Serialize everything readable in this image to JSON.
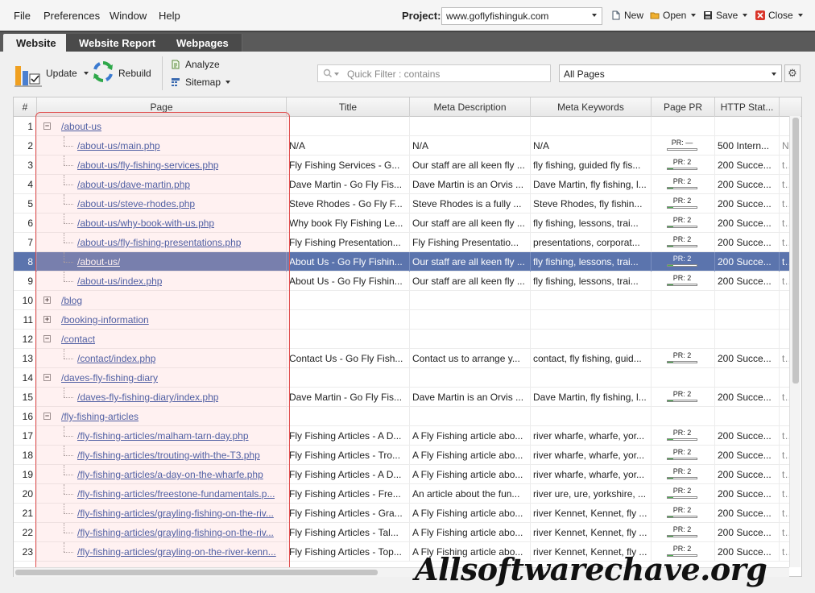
{
  "menu": {
    "file": "File",
    "preferences": "Preferences",
    "window": "Window",
    "help": "Help"
  },
  "project": {
    "label": "Project:",
    "value": "www.goflyfishinguk.com"
  },
  "toolbar_top": {
    "new_label": "New",
    "open_label": "Open",
    "save_label": "Save",
    "close_label": "Close"
  },
  "tabs": [
    "Website",
    "Website Report",
    "Webpages"
  ],
  "actions": {
    "update": "Update",
    "rebuild": "Rebuild",
    "analyze": "Analyze",
    "sitemap": "Sitemap"
  },
  "filter": {
    "placeholder": "Quick Filter : contains",
    "scope": "All Pages"
  },
  "columns": [
    "#",
    "Page",
    "Title",
    "Meta Description",
    "Meta Keywords",
    "Page PR",
    "HTTP Stat..."
  ],
  "rows": [
    {
      "n": "1",
      "page": "/about-us",
      "level": 0,
      "toggle": "minus",
      "title": "",
      "desc": "",
      "kw": "",
      "pr": "",
      "status": "",
      "extra": ""
    },
    {
      "n": "2",
      "page": "/about-us/main.php",
      "level": 1,
      "title": "N/A",
      "desc": "N/A",
      "kw": "N/A",
      "pr": "PR: —",
      "prfill": 0,
      "status": "500 Intern...",
      "extra": "N"
    },
    {
      "n": "3",
      "page": "/about-us/fly-fishing-services.php",
      "level": 1,
      "title": "Fly Fishing Services - G...",
      "desc": "Our staff are all keen fly ...",
      "kw": "fly fishing, guided fly fis...",
      "pr": "PR: 2",
      "prfill": 0.2,
      "status": "200 Succe...",
      "extra": "te"
    },
    {
      "n": "4",
      "page": "/about-us/dave-martin.php",
      "level": 1,
      "title": "Dave Martin - Go Fly Fis...",
      "desc": "Dave Martin is an Orvis ...",
      "kw": "Dave Martin, fly fishing, l...",
      "pr": "PR: 2",
      "prfill": 0.2,
      "status": "200 Succe...",
      "extra": "te"
    },
    {
      "n": "5",
      "page": "/about-us/steve-rhodes.php",
      "level": 1,
      "title": "Steve Rhodes - Go Fly F...",
      "desc": "Steve Rhodes is a fully ...",
      "kw": "Steve Rhodes, fly fishin...",
      "pr": "PR: 2",
      "prfill": 0.2,
      "status": "200 Succe...",
      "extra": "te"
    },
    {
      "n": "6",
      "page": "/about-us/why-book-with-us.php",
      "level": 1,
      "title": "Why book Fly Fishing Le...",
      "desc": "Our staff are all keen fly ...",
      "kw": "fly fishing, lessons, trai...",
      "pr": "PR: 2",
      "prfill": 0.2,
      "status": "200 Succe...",
      "extra": "te"
    },
    {
      "n": "7",
      "page": "/about-us/fly-fishing-presentations.php",
      "level": 1,
      "title": "Fly Fishing Presentation...",
      "desc": "Fly Fishing Presentatio...",
      "kw": "presentations, corporat...",
      "pr": "PR: 2",
      "prfill": 0.2,
      "status": "200 Succe...",
      "extra": "te"
    },
    {
      "n": "8",
      "page": "/about-us/",
      "level": 1,
      "selected": true,
      "title": "About Us - Go Fly Fishin...",
      "desc": "Our staff are all keen fly ...",
      "kw": "fly fishing, lessons, trai...",
      "pr": "PR: 2",
      "prfill": 0.2,
      "status": "200 Succe...",
      "extra": "te"
    },
    {
      "n": "9",
      "page": "/about-us/index.php",
      "level": 1,
      "title": "About Us - Go Fly Fishin...",
      "desc": "Our staff are all keen fly ...",
      "kw": "fly fishing, lessons, trai...",
      "pr": "PR: 2",
      "prfill": 0.2,
      "status": "200 Succe...",
      "extra": "te"
    },
    {
      "n": "10",
      "page": "/blog",
      "level": 0,
      "toggle": "plus",
      "title": "",
      "desc": "",
      "kw": "",
      "pr": "",
      "status": "",
      "extra": ""
    },
    {
      "n": "11",
      "page": "/booking-information",
      "level": 0,
      "toggle": "plus",
      "title": "",
      "desc": "",
      "kw": "",
      "pr": "",
      "status": "",
      "extra": ""
    },
    {
      "n": "12",
      "page": "/contact",
      "level": 0,
      "toggle": "minus",
      "title": "",
      "desc": "",
      "kw": "",
      "pr": "",
      "status": "",
      "extra": ""
    },
    {
      "n": "13",
      "page": "/contact/index.php",
      "level": 1,
      "title": "Contact Us - Go Fly Fish...",
      "desc": "Contact us to arrange y...",
      "kw": "contact, fly fishing, guid...",
      "pr": "PR: 2",
      "prfill": 0.2,
      "status": "200 Succe...",
      "extra": "te"
    },
    {
      "n": "14",
      "page": "/daves-fly-fishing-diary",
      "level": 0,
      "toggle": "minus",
      "title": "",
      "desc": "",
      "kw": "",
      "pr": "",
      "status": "",
      "extra": ""
    },
    {
      "n": "15",
      "page": "/daves-fly-fishing-diary/index.php",
      "level": 1,
      "title": "Dave Martin - Go Fly Fis...",
      "desc": "Dave Martin is an Orvis ...",
      "kw": "Dave Martin, fly fishing, l...",
      "pr": "PR: 2",
      "prfill": 0.2,
      "status": "200 Succe...",
      "extra": "te"
    },
    {
      "n": "16",
      "page": "/fly-fishing-articles",
      "level": 0,
      "toggle": "minus",
      "title": "",
      "desc": "",
      "kw": "",
      "pr": "",
      "status": "",
      "extra": ""
    },
    {
      "n": "17",
      "page": "/fly-fishing-articles/malham-tarn-day.php",
      "level": 1,
      "title": "Fly Fishing Articles - A D...",
      "desc": "A Fly Fishing article abo...",
      "kw": "river wharfe, wharfe, yor...",
      "pr": "PR: 2",
      "prfill": 0.2,
      "status": "200 Succe...",
      "extra": "te"
    },
    {
      "n": "18",
      "page": "/fly-fishing-articles/trouting-with-the-T3.php",
      "level": 1,
      "title": "Fly Fishing Articles - Tro...",
      "desc": "A Fly Fishing article abo...",
      "kw": "river wharfe, wharfe, yor...",
      "pr": "PR: 2",
      "prfill": 0.2,
      "status": "200 Succe...",
      "extra": "te"
    },
    {
      "n": "19",
      "page": "/fly-fishing-articles/a-day-on-the-wharfe.php",
      "level": 1,
      "title": "Fly Fishing Articles - A D...",
      "desc": "A Fly Fishing article abo...",
      "kw": "river wharfe, wharfe, yor...",
      "pr": "PR: 2",
      "prfill": 0.2,
      "status": "200 Succe...",
      "extra": "te"
    },
    {
      "n": "20",
      "page": "/fly-fishing-articles/freestone-fundamentals.p...",
      "level": 1,
      "title": "Fly Fishing Articles - Fre...",
      "desc": "An article about the fun...",
      "kw": "river ure, ure, yorkshire, ...",
      "pr": "PR: 2",
      "prfill": 0.2,
      "status": "200 Succe...",
      "extra": "te"
    },
    {
      "n": "21",
      "page": "/fly-fishing-articles/grayling-fishing-on-the-riv...",
      "level": 1,
      "title": "Fly Fishing Articles - Gra...",
      "desc": "A Fly Fishing article abo...",
      "kw": "river Kennet, Kennet, fly ...",
      "pr": "PR: 2",
      "prfill": 0.2,
      "status": "200 Succe...",
      "extra": "te"
    },
    {
      "n": "22",
      "page": "/fly-fishing-articles/grayling-fishing-on-the-riv...",
      "level": 1,
      "title": "Fly Fishing Articles - Tal...",
      "desc": "A Fly Fishing article abo...",
      "kw": "river Kennet, Kennet, fly ...",
      "pr": "PR: 2",
      "prfill": 0.2,
      "status": "200 Succe...",
      "extra": "te"
    },
    {
      "n": "23",
      "page": "/fly-fishing-articles/grayling-on-the-river-kenn...",
      "level": 1,
      "title": "Fly Fishing Articles - Top...",
      "desc": "A Fly Fishing article abo...",
      "kw": "river Kennet, Kennet, fly ...",
      "pr": "PR: 2",
      "prfill": 0.2,
      "status": "200 Succe...",
      "extra": "te"
    }
  ],
  "watermark": "Allsoftwarechave.org",
  "colors": {
    "selection": "#5b74ad",
    "link": "#2a4ea0",
    "overlay_border": "#e05050",
    "pr_fill": "#4caf50"
  }
}
